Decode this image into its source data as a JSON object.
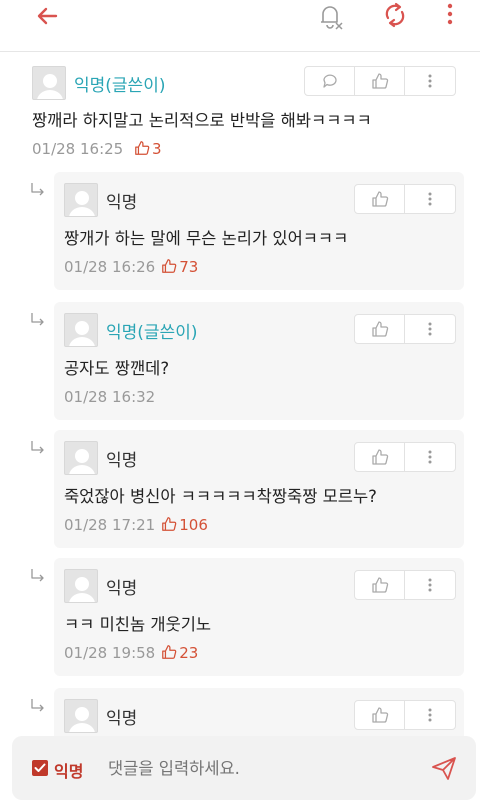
{
  "header": {
    "back_icon": "back-arrow-icon",
    "bell_icon": "notification-off-icon",
    "refresh_icon": "refresh-icon",
    "more_icon": "more-vertical-icon",
    "accent": "#d9534f"
  },
  "comments": [
    {
      "author": "익명(글쓴이)",
      "is_op": true,
      "text": "짱깨라 하지말고 논리적으로 반박을 해봐ㅋㅋㅋㅋ",
      "time": "01/28 16:25",
      "likes": "3"
    },
    {
      "author": "익명",
      "is_op": false,
      "text": "짱개가 하는 말에 무슨 논리가 있어ㅋㅋㅋ",
      "time": "01/28 16:26",
      "likes": "73"
    },
    {
      "author": "익명(글쓴이)",
      "is_op": true,
      "text": "공자도 짱깬데?",
      "time": "01/28 16:32",
      "likes": ""
    },
    {
      "author": "익명",
      "is_op": false,
      "text": "죽었잖아 병신아 ㅋㅋㅋㅋㅋ착짱죽짱 모르누?",
      "time": "01/28 17:21",
      "likes": "106"
    },
    {
      "author": "익명",
      "is_op": false,
      "text": "ㅋㅋ 미친놈 개웃기노",
      "time": "01/28 19:58",
      "likes": "23"
    },
    {
      "author": "익명",
      "is_op": false,
      "text": "",
      "time": "",
      "likes": ""
    }
  ],
  "composer": {
    "anon_label": "익명",
    "placeholder": "댓글을 입력하세요.",
    "send_icon": "send-icon"
  }
}
